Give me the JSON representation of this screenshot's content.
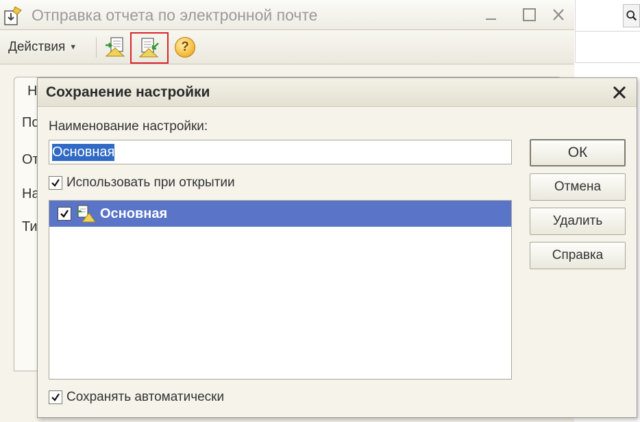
{
  "background_window": {
    "title": "Отправка отчета по электронной почте",
    "toolbar": {
      "actions_label": "Действия",
      "help_symbol": "?"
    },
    "tab_fragment": "Н",
    "field_fragments": [
      "По",
      "От",
      "На",
      "Ти"
    ]
  },
  "dialog": {
    "title": "Сохранение настройки",
    "name_label": "Наименование настройки:",
    "name_value": "Основная",
    "use_on_open": {
      "label": "Использовать при открытии",
      "checked": true
    },
    "settings_list": [
      {
        "label": "Основная",
        "checked": true,
        "selected": true
      }
    ],
    "auto_save": {
      "label": "Сохранять автоматически",
      "checked": true
    },
    "buttons": {
      "ok": "ОК",
      "cancel": "Отмена",
      "delete": "Удалить",
      "help": "Справка"
    }
  },
  "colors": {
    "selection": "#5a74c8",
    "text_selection": "#316ac5",
    "highlight_frame": "#d9232d",
    "window_bg": "#f5f3ea"
  }
}
